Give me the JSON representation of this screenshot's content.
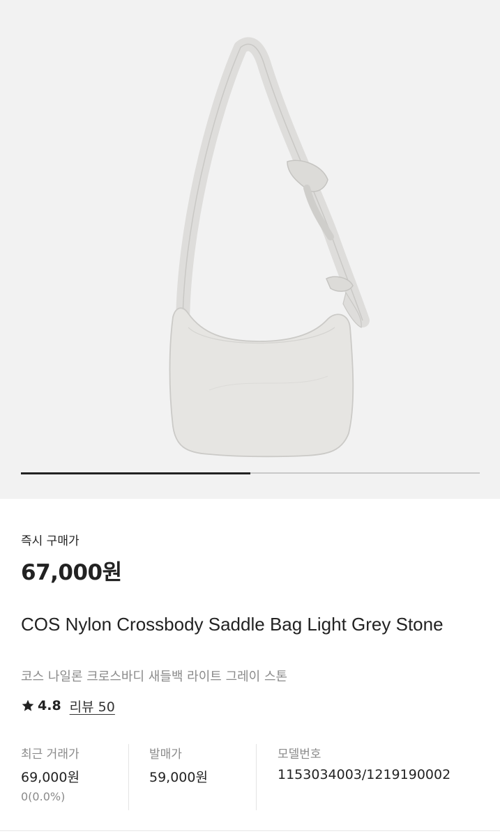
{
  "gallery": {
    "image_description_icon": "product-photo",
    "progress_fraction": 0.5
  },
  "price": {
    "label": "즉시 구매가",
    "value": "67,000원"
  },
  "product": {
    "title_en": "COS Nylon Crossbody Saddle Bag Light Grey Stone",
    "title_ko": "코스 나일론 크로스바디 새들백 라이트 그레이 스톤"
  },
  "rating": {
    "icon": "star-icon",
    "value": "4.8",
    "review_link": "리뷰 50"
  },
  "stats": {
    "recent": {
      "label": "최근 거래가",
      "value": "69,000원",
      "change": "0(0.0%)"
    },
    "release": {
      "label": "발매가",
      "value": "59,000원"
    },
    "model": {
      "label": "모델번호",
      "value": "1153034003/1219190002"
    }
  },
  "colors": {
    "hero_bg": "#f2f2f2",
    "text_primary": "#222222",
    "text_secondary": "#8a8a8a"
  }
}
